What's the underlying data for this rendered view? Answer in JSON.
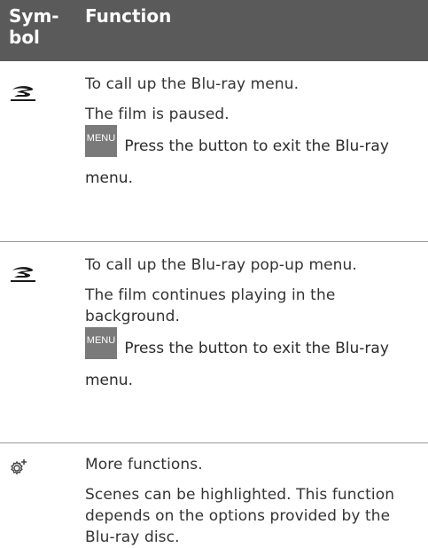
{
  "header": {
    "symbol_label_1": "Sym-",
    "symbol_label_2": "bol",
    "function_label": "Function"
  },
  "rows": [
    {
      "icon": "blu-ray-disc-icon",
      "lines": [
        "To call up the Blu-ray menu.",
        "The film is paused."
      ],
      "menu_button_label": "MENU",
      "menu_text": "Press the button to exit the Blu-ray menu."
    },
    {
      "icon": "blu-ray-disc-icon",
      "lines": [
        "To call up the Blu-ray pop-up menu.",
        "The film continues playing in the background."
      ],
      "menu_button_label": "MENU",
      "menu_text": "Press the button to exit the Blu-ray menu."
    },
    {
      "icon": "settings-plus-icon",
      "lines": [
        "More  functions.",
        "Scenes can be highlighted. This function depends on the options provided by the Blu-ray disc."
      ]
    }
  ],
  "colors": {
    "header_bg": "#5a5a5a",
    "menu_button_bg": "#7a7a7a",
    "divider": "#9a9a9a"
  }
}
